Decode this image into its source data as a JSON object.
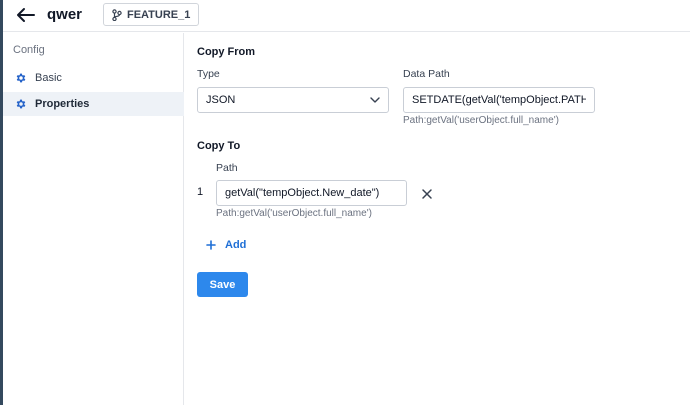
{
  "header": {
    "title": "qwer",
    "branch_label": "FEATURE_1",
    "back_icon": "arrow-left-icon",
    "branch_icon": "git-branch-icon"
  },
  "sidebar": {
    "heading": "Config",
    "items": [
      {
        "label": "Basic",
        "icon": "gear-icon",
        "active": false
      },
      {
        "label": "Properties",
        "icon": "gear-icon",
        "active": true
      }
    ]
  },
  "copy_from": {
    "title": "Copy From",
    "type_label": "Type",
    "type_value": "JSON",
    "data_path_label": "Data Path",
    "data_path_value": "SETDATE(getVal('tempObject.PATH.start",
    "data_path_hint": "Path:getVal('userObject.full_name')"
  },
  "copy_to": {
    "title": "Copy To",
    "path_label": "Path",
    "rows": [
      {
        "index": "1",
        "value": "getVal(\"tempObject.New_date\")",
        "hint": "Path:getVal('userObject.full_name')"
      }
    ],
    "add_label": "Add"
  },
  "actions": {
    "save_label": "Save"
  },
  "colors": {
    "primary": "#2d88ec",
    "link": "#1f6fd6",
    "active_bg": "#eef2f7",
    "strip": "#34495e"
  }
}
